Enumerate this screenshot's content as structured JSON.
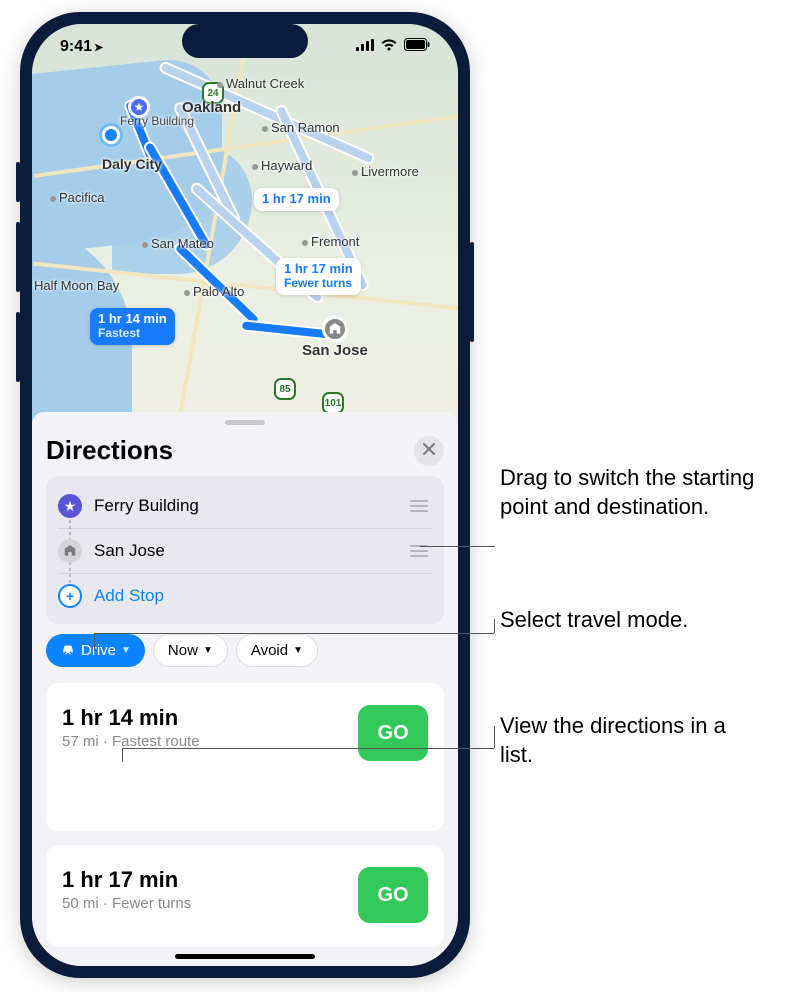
{
  "status_bar": {
    "time": "9:41",
    "location_icon": "➤"
  },
  "map": {
    "cities": {
      "walnut_creek": "Walnut Creek",
      "oakland": "Oakland",
      "san_ramon": "San Ramon",
      "daly_city": "Daly City",
      "hayward": "Hayward",
      "livermore": "Livermore",
      "pacifica": "Pacifica",
      "san_mateo": "San Mateo",
      "fremont": "Fremont",
      "half_moon_bay": "Half Moon Bay",
      "palo_alto": "Palo Alto",
      "san_jose": "San Jose"
    },
    "origin_label": "Ferry Building",
    "route_labels": [
      {
        "time": "1 hr 14 min",
        "subtitle": "Fastest",
        "type": "primary"
      },
      {
        "time": "1 hr 17 min",
        "subtitle": "Fewer turns",
        "type": "secondary"
      },
      {
        "time": "1 hr 17 min",
        "subtitle": "",
        "type": "secondary"
      }
    ],
    "highway_shields": [
      "24",
      "85",
      "101"
    ]
  },
  "sheet": {
    "title": "Directions",
    "stops": [
      {
        "label": "Ferry Building",
        "icon": "star"
      },
      {
        "label": "San Jose",
        "icon": "dest"
      }
    ],
    "add_stop_label": "Add Stop",
    "mode_chip": "Drive",
    "now_chip": "Now",
    "avoid_chip": "Avoid",
    "results": [
      {
        "time": "1 hr 14 min",
        "subtitle": "57 mi · Fastest route",
        "go": "GO"
      },
      {
        "time": "1 hr 17 min",
        "subtitle": "50 mi · Fewer turns",
        "go": "GO"
      }
    ]
  },
  "annotations": {
    "drag": "Drag to switch the starting point and destination.",
    "mode": "Select travel mode.",
    "list": "View the directions in a list."
  }
}
